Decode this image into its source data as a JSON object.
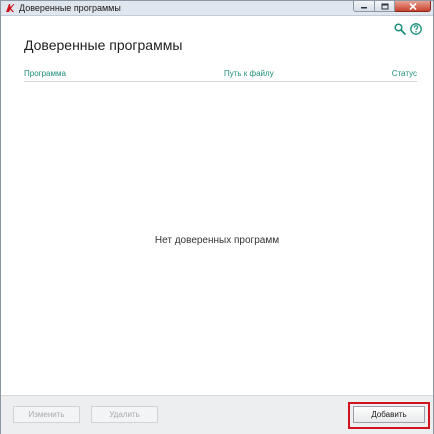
{
  "window": {
    "title": "Доверенные программы"
  },
  "header": {
    "title": "Доверенные программы",
    "icons": [
      "search-icon",
      "help-icon"
    ]
  },
  "table": {
    "columns": [
      "Программа",
      "Путь к файлу",
      "Статус"
    ],
    "empty_message": "Нет доверенных программ"
  },
  "footer": {
    "edit_label": "Изменить",
    "delete_label": "Удалить",
    "add_label": "Добавить"
  },
  "colors": {
    "accent": "#1e8f7a",
    "highlight": "#d0131d"
  }
}
